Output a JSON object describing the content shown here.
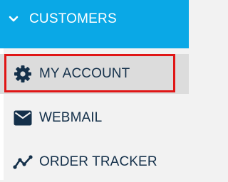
{
  "header": {
    "label": "CUSTOMERS",
    "icon": "chevron-down-icon",
    "background": "#0aa8e6",
    "text_color": "#ffffff"
  },
  "menu": {
    "items": [
      {
        "label": "MY ACCOUNT",
        "icon": "gear-icon",
        "selected": true
      },
      {
        "label": "WEBMAIL",
        "icon": "envelope-icon",
        "selected": false
      },
      {
        "label": "ORDER TRACKER",
        "icon": "trend-line-icon",
        "selected": false
      }
    ],
    "text_color": "#14304a",
    "highlight_border_color": "#e01616"
  }
}
